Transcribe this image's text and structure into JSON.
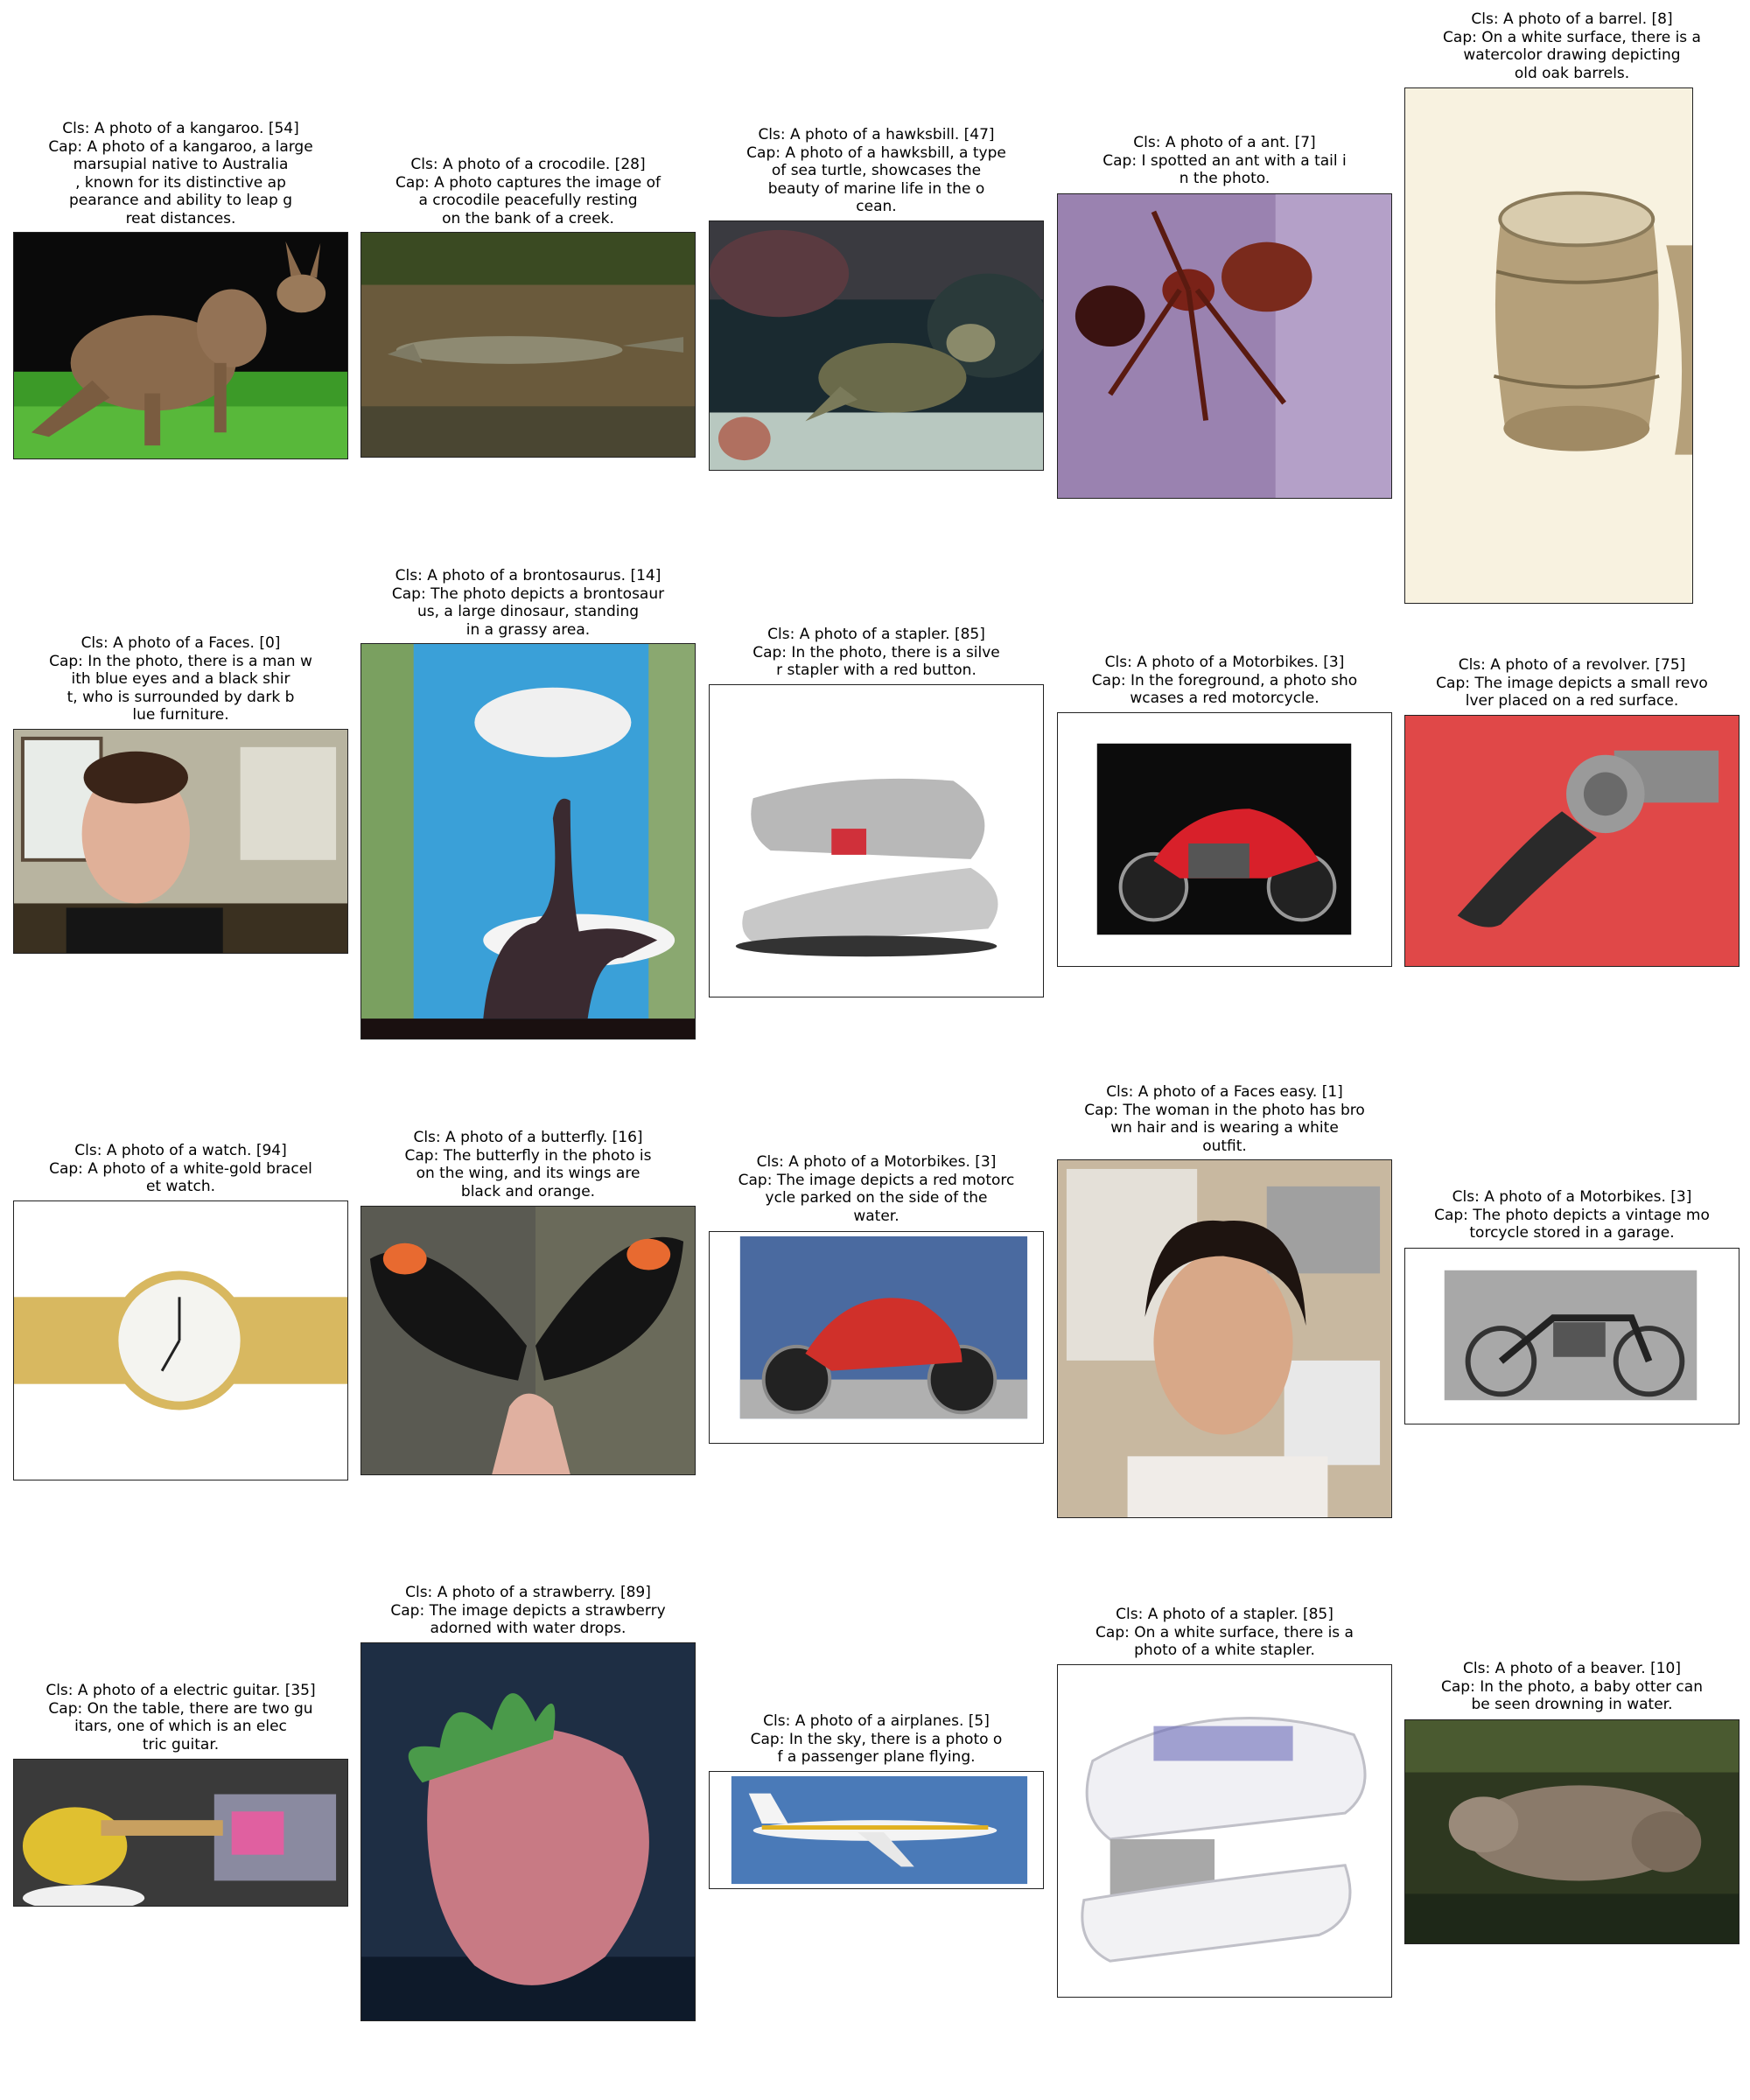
{
  "panels": [
    {
      "cls": "Cls: A photo of a kangaroo. [54]",
      "cap": "Cap: A photo of a kangaroo, a large\nmarsupial native to Australia\n, known for its distinctive ap\npearance and ability to leap g\nreat distances.",
      "image": "kangaroo on green grass, black background"
    },
    {
      "cls": "Cls: A photo of a crocodile. [28]",
      "cap": "Cap: A photo captures the image of\na crocodile peacefully resting\non the bank of a creek.",
      "image": "crocodile on muddy creek bank"
    },
    {
      "cls": "Cls: A photo of a hawksbill. [47]",
      "cap": "Cap: A photo of a hawksbill, a type\nof sea turtle, showcases the\nbeauty of marine life in the o\ncean.",
      "image": "sea turtle underwater on reef"
    },
    {
      "cls": "Cls: A photo of a ant. [7]",
      "cap": "Cap: I spotted an ant with a tail i\nn the photo.",
      "image": "red ant on purple surface"
    },
    {
      "cls": "Cls: A photo of a barrel. [8]",
      "cap": "Cap: On a white surface, there is a\nwatercolor drawing depicting\nold oak barrels.",
      "image": "watercolor drawing of wooden barrels"
    },
    {
      "cls": "Cls: A photo of a Faces. [0]",
      "cap": "Cap: In the photo, there is a man w\nith blue eyes and a black shir\nt, who is surrounded by dark b\nlue furniture.",
      "image": "portrait of a man in an office"
    },
    {
      "cls": "Cls: A photo of a brontosaurus. [14]",
      "cap": "Cap: The photo depicts a brontosaur\nus, a large dinosaur, standing\nin a grassy area.",
      "image": "brontosaurus silhouette against blue sky"
    },
    {
      "cls": "Cls: A photo of a stapler. [85]",
      "cap": "Cap: In the photo, there is a silve\nr stapler with a red button.",
      "image": "silver stapler"
    },
    {
      "cls": "Cls: A photo of a Motorbikes. [3]",
      "cap": "Cap: In the foreground, a photo sho\nwcases a red motorcycle.",
      "image": "red sport motorcycle on black"
    },
    {
      "cls": "Cls: A photo of a revolver. [75]",
      "cap": "Cap: The image depicts a small revo\nlver placed on a red surface.",
      "image": "engraved revolver on red cloth"
    },
    {
      "cls": "Cls: A photo of a watch. [94]",
      "cap": "Cap: A photo of a white-gold bracel\net watch.",
      "image": "gold bracelet watch with white dial"
    },
    {
      "cls": "Cls: A photo of a butterfly. [16]",
      "cap": "Cap: The butterfly in the photo is\non the wing, and its wings are\nblack and orange.",
      "image": "black and orange butterfly on a finger"
    },
    {
      "cls": "Cls: A photo of a Motorbikes. [3]",
      "cap": "Cap: The image depicts a red motorc\nycle parked on the side of the\nwater.",
      "image": "red naked motorcycle by water"
    },
    {
      "cls": "Cls: A photo of a Faces easy. [1]",
      "cap": "Cap: The woman in the photo has bro\nwn hair and is wearing a white\noutfit.",
      "image": "portrait of a woman in front of a bulletin board"
    },
    {
      "cls": "Cls: A photo of a Motorbikes. [3]",
      "cap": "Cap: The photo depicts a vintage mo\ntorcycle stored in a garage.",
      "image": "black and white vintage motorcycle"
    },
    {
      "cls": "Cls: A photo of a electric guitar. [35]",
      "cap": "Cap: On the table, there are two gu\nitars, one of which is an elec\ntric guitar.",
      "image": "yellow electric guitar"
    },
    {
      "cls": "Cls: A photo of a strawberry. [89]",
      "cap": "Cap: The image depicts a strawberry\nadorned with water drops.",
      "image": "large pink strawberry on dark blue"
    },
    {
      "cls": "Cls: A photo of a airplanes. [5]",
      "cap": "Cap: In the sky, there is a photo o\nf a passenger plane flying.",
      "image": "passenger jet in blue sky"
    },
    {
      "cls": "Cls: A photo of a stapler. [85]",
      "cap": "Cap: On a white surface, there is a\nphoto of a white stapler.",
      "image": "white stapler"
    },
    {
      "cls": "Cls: A photo of a beaver. [10]",
      "cap": "Cap: In the photo, a baby otter can\nbe seen drowning in water.",
      "image": "wet beaver among grass"
    }
  ]
}
